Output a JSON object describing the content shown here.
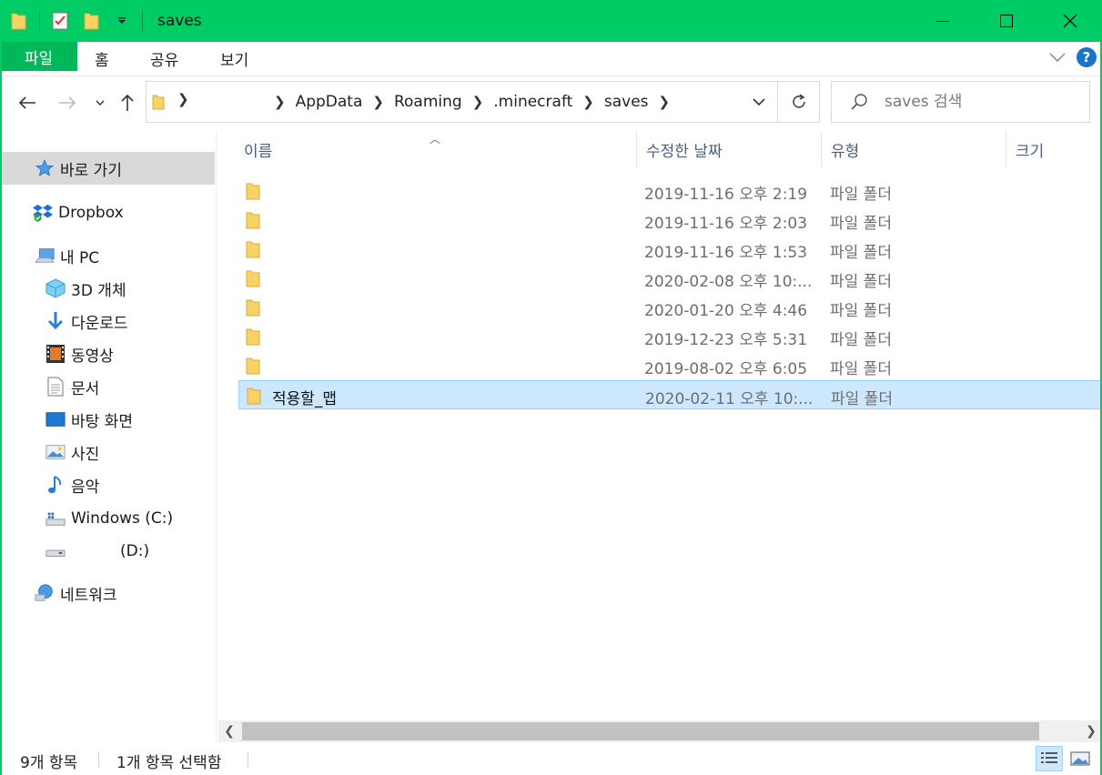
{
  "window": {
    "title": "saves"
  },
  "ribbon": {
    "tabs": [
      {
        "label": "파일",
        "active": true
      },
      {
        "label": "홈"
      },
      {
        "label": "공유"
      },
      {
        "label": "보기"
      }
    ]
  },
  "address": {
    "breadcrumbs": [
      "AppData",
      "Roaming",
      ".minecraft",
      "saves"
    ]
  },
  "search": {
    "placeholder": "saves 검색"
  },
  "sidebar": {
    "items": [
      {
        "label": "바로 가기",
        "icon": "star-icon"
      },
      {
        "label": "Dropbox",
        "icon": "dropbox-icon"
      },
      {
        "label": "내 PC",
        "icon": "computer-icon"
      },
      {
        "label": "3D 개체",
        "icon": "cube-icon"
      },
      {
        "label": "다운로드",
        "icon": "download-icon"
      },
      {
        "label": "동영상",
        "icon": "video-icon"
      },
      {
        "label": "문서",
        "icon": "document-icon"
      },
      {
        "label": "바탕 화면",
        "icon": "desktop-icon"
      },
      {
        "label": "사진",
        "icon": "picture-icon"
      },
      {
        "label": "음악",
        "icon": "music-icon"
      },
      {
        "label": "Windows (C:)",
        "icon": "drive-c-icon"
      },
      {
        "label": "(D:)",
        "icon": "drive-d-icon"
      },
      {
        "label": "네트워크",
        "icon": "network-icon"
      }
    ]
  },
  "columns": {
    "name": "이름",
    "date": "수정한 날짜",
    "type": "유형",
    "size": "크기"
  },
  "files": [
    {
      "name": "",
      "date": "2019-11-16 오후 2:19",
      "type": "파일 폴더"
    },
    {
      "name": "",
      "date": "2019-11-16 오후 2:03",
      "type": "파일 폴더"
    },
    {
      "name": "",
      "date": "2019-11-16 오후 1:53",
      "type": "파일 폴더"
    },
    {
      "name": "",
      "date": "2020-02-08 오후 10:...",
      "type": "파일 폴더"
    },
    {
      "name": "",
      "date": "2020-01-20 오후 4:46",
      "type": "파일 폴더"
    },
    {
      "name": "",
      "date": "2019-12-23 오후 5:31",
      "type": "파일 폴더"
    },
    {
      "name": "",
      "date": "2019-08-02 오후 6:05",
      "type": "파일 폴더"
    },
    {
      "name": "적용할_맵",
      "date": "2020-02-11 오후 10:...",
      "type": "파일 폴더",
      "selected": true
    }
  ],
  "status": {
    "count": "9개 항목",
    "selected": "1개 항목 선택함"
  },
  "colors": {
    "titlebar": "#00cc66",
    "file_tab": "#00b85a",
    "selection": "#cce8ff",
    "folder": "#f7d366"
  }
}
